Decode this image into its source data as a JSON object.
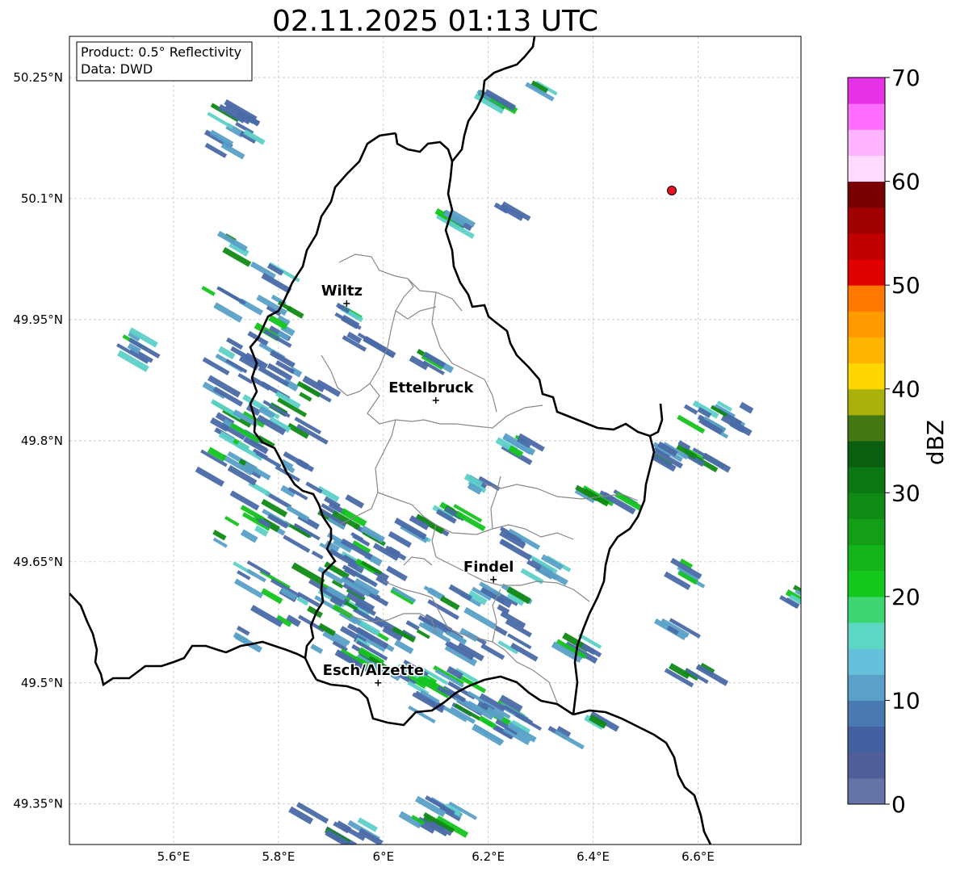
{
  "title": "02.11.2025 01:13 UTC",
  "info_box": {
    "product": "Product: 0.5° Reflectivity",
    "source": "Data: DWD"
  },
  "axes": {
    "lon_ticks": [
      "5.6°E",
      "5.8°E",
      "6°E",
      "6.2°E",
      "6.4°E",
      "6.6°E"
    ],
    "lat_ticks": [
      "50.25°N",
      "50.1°N",
      "49.95°N",
      "49.8°N",
      "49.65°N",
      "49.5°N",
      "49.35°N"
    ],
    "lon_values": [
      5.6,
      5.8,
      6.0,
      6.2,
      6.4,
      6.6
    ],
    "lat_values": [
      50.25,
      50.1,
      49.95,
      49.8,
      49.65,
      49.5,
      49.35
    ],
    "lon_range": [
      5.4,
      6.8
    ],
    "lat_range": [
      49.3,
      50.3
    ]
  },
  "cities": [
    {
      "name": "Wiltz",
      "lon": 5.93,
      "lat": 49.97
    },
    {
      "name": "Ettelbruck",
      "lon": 6.1,
      "lat": 49.85
    },
    {
      "name": "Findel",
      "lon": 6.21,
      "lat": 49.628
    },
    {
      "name": "Esch/Alzette",
      "lon": 5.99,
      "lat": 49.5
    }
  ],
  "radar_site": {
    "lon": 6.55,
    "lat": 50.11,
    "color": "#e8141c"
  },
  "colorbar": {
    "label": "dBZ",
    "tick_labels": [
      "0",
      "10",
      "20",
      "30",
      "40",
      "50",
      "60",
      "70"
    ],
    "colors": [
      "#6673a6",
      "#505f9a",
      "#4360a0",
      "#4a78b0",
      "#5aa0c8",
      "#65c0dc",
      "#5dd6c4",
      "#3dd672",
      "#14c81e",
      "#14b41a",
      "#149e18",
      "#108a14",
      "#0c7612",
      "#0a5e10",
      "#447812",
      "#a8b20a",
      "#ffd700",
      "#ffb400",
      "#ff9a00",
      "#ff7800",
      "#e00000",
      "#c00000",
      "#a00000",
      "#780000",
      "#ffdcff",
      "#ffb4ff",
      "#ff6eff",
      "#e632e6"
    ]
  },
  "echo_colors": {
    "weak": "#4a6aa8",
    "light": "#5aa0c8",
    "cyan": "#5dd0c8",
    "green": "#14c41e",
    "dark_green": "#108a14"
  }
}
